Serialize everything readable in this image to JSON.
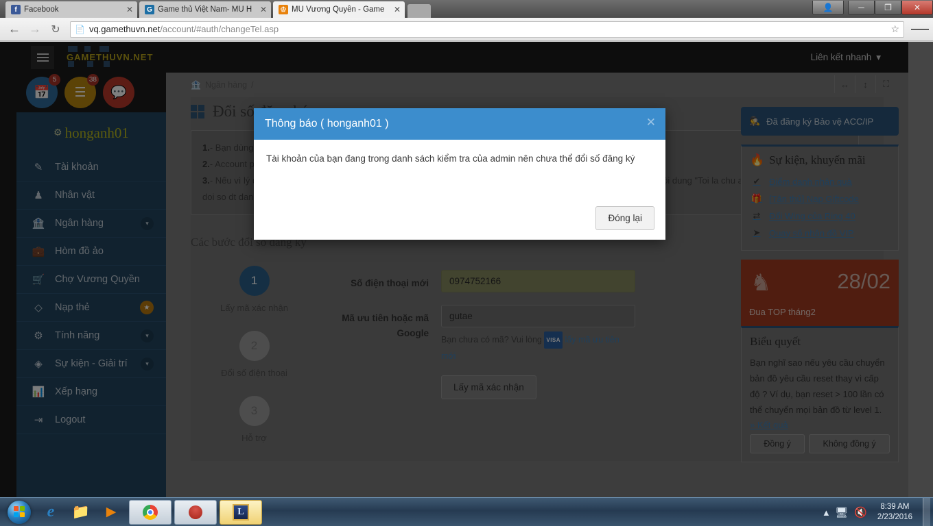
{
  "browser": {
    "tabs": [
      {
        "label": "Facebook",
        "favicon": "facebook-icon",
        "favicon_char": "f",
        "favicon_color": "#3b5998",
        "active": false
      },
      {
        "label": "Game thủ Việt Nam- MU H",
        "favicon": "gamethu-icon",
        "favicon_char": "G",
        "favicon_color": "#1d6fa5",
        "active": false
      },
      {
        "label": "MU Vương Quyền - Game",
        "favicon": "crown-icon",
        "favicon_char": "♕",
        "favicon_color": "#e8820c",
        "active": true
      }
    ],
    "url_host": "vq.gamethuvn.net",
    "url_path": "/account/#auth/changeTel.asp",
    "window_controls": {
      "person": "☺",
      "minimize": "–",
      "maximize": "❐",
      "close": "✕"
    },
    "nav": {
      "back": "←",
      "forward": "→",
      "reload": "⟳",
      "star": "☆"
    }
  },
  "site": {
    "brand": "GAMETHUVN.NET",
    "quicklinks_label": "Liên kết nhanh",
    "header_icons": [
      {
        "name": "calendar-icon",
        "glyph": "Ὄ5",
        "badge": "5",
        "color": "blue"
      },
      {
        "name": "list-icon",
        "glyph": "☰",
        "badge": "38",
        "color": "gold"
      },
      {
        "name": "chat-icon",
        "glyph": "ὊC",
        "badge": "",
        "color": "red"
      }
    ],
    "username": "honganh01"
  },
  "sidebar": {
    "items": [
      {
        "label": "Tài khoản",
        "icon": "edit-square-icon",
        "glyph": "✎",
        "caret": false,
        "star": false
      },
      {
        "label": "Nhân vật",
        "icon": "user-icon",
        "glyph": "♟",
        "caret": false,
        "star": false
      },
      {
        "label": "Ngân hàng",
        "icon": "bank-icon",
        "glyph": "Ἶ6",
        "caret": true,
        "star": false
      },
      {
        "label": "Hòm đồ ảo",
        "icon": "briefcase-icon",
        "glyph": "ὋC",
        "caret": false,
        "star": false
      },
      {
        "label": "Chợ Vương Quyền",
        "icon": "cart-icon",
        "glyph": "Ὥ2",
        "caret": false,
        "star": false
      },
      {
        "label": "Nạp thẻ",
        "icon": "diamond-icon",
        "glyph": "◇",
        "caret": false,
        "star": true
      },
      {
        "label": "Tính năng",
        "icon": "gears-icon",
        "glyph": "⚙",
        "caret": true,
        "star": false
      },
      {
        "label": "Sự kiện - Giải trí",
        "icon": "code-icon",
        "glyph": "◈",
        "caret": true,
        "star": false
      },
      {
        "label": "Xếp hạng",
        "icon": "bar-chart-icon",
        "glyph": "ὌA",
        "caret": false,
        "star": false
      },
      {
        "label": "Logout",
        "icon": "logout-icon",
        "glyph": "→",
        "caret": false,
        "star": false
      }
    ]
  },
  "breadcrumb": {
    "icon": "bank-icon",
    "item": "Ngân hàng",
    "separator": "/"
  },
  "viewbuttons": [
    {
      "name": "width-toggle-icon",
      "glyph": "↔"
    },
    {
      "name": "height-toggle-icon",
      "glyph": "↕"
    },
    {
      "name": "fullscreen-icon",
      "glyph": "⛶"
    }
  ],
  "main": {
    "page_title": "Đổi số đăng ký",
    "notes": [
      {
        "num": "1.",
        "text": "- Bạn dùng tính năng này để đổi số điện thoại đăng ký bằng cách click vào nút lấy mã bên dưới"
      },
      {
        "num": "2.",
        "text": "- Account phải có 1 nhân vật reset trên 20 lần mới được đổi số. Mỗi lần đổi số điện thoại phải cách nhau 72 giờ"
      },
      {
        "num": "3.",
        "text": "- Nếu vì lý do gì đó bạn không nhận được mã đổi số hoặc đổi số thất bại, hãy nhắn yêu cầu đến 0904454444 với nội dung \"Toi la chu account ... server VQ muon doi so dt dang ky sang so .... \" . Yêu cầu của bạn sẽ được thực hiện trong vòng 24h"
      }
    ],
    "steps_title": "Các bước đổi số đăng ký",
    "steps": [
      {
        "num": "1",
        "label": "Lấy mã xác nhận",
        "active": true
      },
      {
        "num": "2",
        "label": "Đổi số điện thoại",
        "active": false
      },
      {
        "num": "3",
        "label": "Hỗ trợ",
        "active": false
      }
    ],
    "form": {
      "phone_label": "Số điện thoại mới",
      "phone_value": "0974752166",
      "phone_placeholder": "Số điện thoại mới",
      "code_label": "Mã ưu tiên hoặc mã Google",
      "code_value": "gutae",
      "code_placeholder": "Mã ưu tiên",
      "hint_prefix": "Bạn chưa có mã? Vui lòng",
      "hint_badge": "VISA",
      "hint_link": "lấy mã ưu tiên mới",
      "submit_label": "Lấy mã xác nhận"
    }
  },
  "rightcol": {
    "acc_button": {
      "label": "Đã đăng ký Bảo vệ ACC/IP",
      "icon": "detective-icon",
      "glyph": "ὗ5"
    },
    "events": {
      "title": "Sự kiện, khuyến mãi",
      "title_icon": "fire-icon",
      "links": [
        {
          "label": "Điểm danh nhận quà",
          "icon": "check-circle-icon",
          "glyph": "✔"
        },
        {
          "label": "[Tân thủ] Nạp Giftcode",
          "icon": "gift-icon",
          "glyph": "Ἰ1"
        },
        {
          "label": "Đổi Wing của Ring 40",
          "icon": "exchange-icon",
          "glyph": "⇄"
        },
        {
          "label": "Quay số nhận đồ VIP",
          "icon": "bolt-icon",
          "glyph": "➤"
        }
      ]
    },
    "promo": {
      "date": "28/02",
      "title": "Đua TOP tháng2",
      "icon": "knight-icon",
      "glyph": "♞"
    },
    "poll": {
      "title": "Biểu quyết",
      "text": "Bạn nghĩ sao nếu yêu cầu chuyển bản đồ yêu cầu reset thay vì cấp độ ? Ví dụ, bạn reset > 100 lần có thể chuyển mọi bản đồ từ level 1.",
      "result_link": "» Kết quả",
      "agree_label": "Đồng ý",
      "disagree_label": "Không đồng ý"
    }
  },
  "modal": {
    "title": "Thông báo ( honganh01 )",
    "close_glyph": "✕",
    "message": "Tài khoản của bạn đang trong danh sách kiểm tra của admin nên chưa thể đổi số đăng ký",
    "button_label": "Đóng lại",
    "header_color": "#3c8dcd"
  },
  "taskbar": {
    "start_label": "Start",
    "quicklaunch": [
      {
        "name": "internet-explorer-icon",
        "glyph": "e"
      },
      {
        "name": "file-explorer-icon",
        "glyph": "Ὄ1"
      },
      {
        "name": "media-player-icon",
        "glyph": "▶"
      }
    ],
    "tasks": [
      {
        "name": "chrome-task",
        "glyph": "●",
        "highlight": false
      },
      {
        "name": "game-task",
        "glyph": "●",
        "highlight": false
      },
      {
        "name": "league-task",
        "glyph": "L",
        "highlight": true
      }
    ],
    "tray": [
      {
        "name": "show-hidden-icons",
        "glyph": "▲"
      },
      {
        "name": "network-icon",
        "glyph": "὚5"
      },
      {
        "name": "volume-muted-icon",
        "glyph": "ὐ7"
      }
    ],
    "time": "8:39 AM",
    "date": "2/23/2016"
  }
}
